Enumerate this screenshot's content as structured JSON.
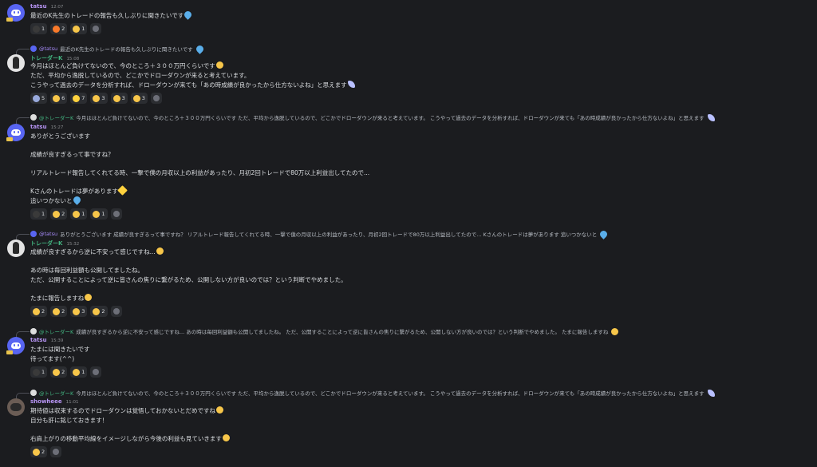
{
  "messages": [
    {
      "author": "tatsu",
      "time": "12:07",
      "lines": [
        "最近のK先生のトレードの報告も久しぶりに聞きたいです"
      ],
      "reactions": [
        {
          "icon": "ninja-emoji",
          "count": "1",
          "color": "#444"
        },
        {
          "icon": "fire-emoji",
          "count": "2",
          "color": "#f97a2a"
        },
        {
          "icon": "thumbs-up-emoji",
          "count": "1",
          "color": "#f7c64a"
        }
      ]
    },
    {
      "reply_author": "@tatsu",
      "reply_text": "最近のK先生のトレードの報告も久しぶりに聞きたいです",
      "author": "トレーダーK",
      "time": "15:08",
      "lines": [
        "今月はほとんど負けてないので、今のところ＋３００万円くらいです",
        "ただ、平均から逸脱しているので、どこかでドローダウンが来ると考えています。",
        "こうやって過去のデータを分析すれば、ドローダウンが来ても「あの時成績が良かったから仕方ないよね」と思えます"
      ],
      "reactions": [
        {
          "icon": "bathing-emoji",
          "count": "5",
          "color": "#9ad"
        },
        {
          "icon": "heart-eyes-emoji",
          "count": "6",
          "color": "#f7c64a"
        },
        {
          "icon": "sparkles-emoji",
          "count": "7",
          "color": "#ffd23e"
        },
        {
          "icon": "grin-emoji",
          "count": "3",
          "color": "#f7c64a"
        },
        {
          "icon": "thumbs-up-emoji",
          "count": "3",
          "color": "#f7c64a"
        },
        {
          "icon": "clap-emoji",
          "count": "3",
          "color": "#f7c64a"
        }
      ]
    },
    {
      "reply_author": "@トレーダーK",
      "reply_text": "今月はほとんど負けてないので、今のところ＋３００万円くらいです ただ、平均から逸脱しているので、どこかでドローダウンが来ると考えています。 こうやって過去のデータを分析すれば、ドローダウンが来ても「あの時成績が良かったから仕方ないよね」と思えます",
      "author": "tatsu",
      "time": "15:27",
      "lines": [
        "ありがとうございます",
        "",
        "成績が良すぎるって事ですね？",
        "",
        "リアルトレード報告してくれてる時、一撃で僕の月収以上の利益があったり、月初2回トレードで80万以上利益出してたので...",
        "",
        "Kさんのトレードは夢があります",
        "追いつかないと"
      ],
      "reactions": [
        {
          "icon": "ninja-emoji",
          "count": "1",
          "color": "#444"
        },
        {
          "icon": "grin-emoji",
          "count": "2",
          "color": "#f7c64a"
        },
        {
          "icon": "thumbs-up-emoji",
          "count": "1",
          "color": "#f7c64a"
        },
        {
          "icon": "muscle-emoji",
          "count": "1",
          "color": "#f7c64a"
        }
      ]
    },
    {
      "reply_author": "@tatsu",
      "reply_text": "ありがとうございます 成績が良すぎるって事ですね？ リアルトレード報告してくれてる時、一撃で僕の月収以上の利益があったり、月初2回トレードで80万以上利益出してたので... Kさんのトレードは夢があります 追いつかないと",
      "author": "トレーダーK",
      "time": "15:32",
      "lines": [
        "成績が良すぎるから逆に不安って感じですね...",
        "",
        "あの時は毎回利益額も公開してましたね。",
        "ただ、公開することによって逆に皆さんの焦りに繋がるため、公開しない方が良いのでは？という判断でやめました。",
        "",
        "たまに報告しますね"
      ],
      "reactions": [
        {
          "icon": "thinking-emoji",
          "count": "2",
          "color": "#f7c64a"
        },
        {
          "icon": "surprised-emoji",
          "count": "2",
          "color": "#f7c64a"
        },
        {
          "icon": "thumbs-up-emoji",
          "count": "3",
          "color": "#f7c64a"
        },
        {
          "icon": "hearts-face-emoji",
          "count": "2",
          "color": "#f7c64a"
        }
      ]
    },
    {
      "reply_author": "@トレーダーK",
      "reply_text": "成績が良すぎるから逆に不安って感じですね... あの時は毎回利益額も公開してましたね。 ただ、公開することによって逆に皆さんの焦りに繋がるため、公開しない方が良いのでは？という判断でやめました。 たまに報告しますね",
      "author": "tatsu",
      "time": "15:39",
      "lines": [
        "たまには聞きたいです",
        "待ってます(^^)"
      ],
      "reactions": [
        {
          "icon": "ninja-emoji",
          "count": "1",
          "color": "#444"
        },
        {
          "icon": "blush-emoji",
          "count": "2",
          "color": "#f7c64a"
        },
        {
          "icon": "thumbs-up-emoji",
          "count": "1",
          "color": "#f7c64a"
        }
      ]
    },
    {
      "reply_author": "@トレーダーK",
      "reply_text": "今月はほとんど負けてないので、今のところ＋３００万円くらいです ただ、平均から逸脱しているので、どこかでドローダウンが来ると考えています。 こうやって過去のデータを分析すれば、ドローダウンが来ても「あの時成績が良かったから仕方ないよね」と思えます",
      "author": "showheee",
      "time": "11:01",
      "lines": [
        "期待値は収束するのでドローダウンは覚悟しておかないとだめですね",
        "自分も肝に銘じておきます！",
        "",
        "右肩上がりの移動平均線をイメージしながら今後の利益も見ていきます"
      ],
      "reactions": [
        {
          "icon": "thumbs-up-emoji",
          "count": "2",
          "color": "#f7c64a"
        }
      ]
    }
  ]
}
